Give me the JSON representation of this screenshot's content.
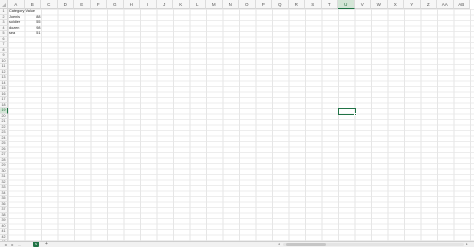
{
  "columns": [
    "A",
    "B",
    "C",
    "D",
    "E",
    "F",
    "G",
    "H",
    "I",
    "J",
    "K",
    "L",
    "M",
    "N",
    "O",
    "P",
    "Q",
    "R",
    "S",
    "T",
    "U",
    "V",
    "W",
    "X",
    "Y",
    "Z",
    "AA",
    "AB"
  ],
  "rows": [
    "1",
    "2",
    "3",
    "4",
    "5",
    "6",
    "7",
    "8",
    "9",
    "10",
    "11",
    "12",
    "13",
    "14",
    "15",
    "16",
    "17",
    "18",
    "19",
    "20",
    "21",
    "22",
    "23",
    "24",
    "25",
    "26",
    "27",
    "28",
    "29",
    "30",
    "31",
    "32",
    "33",
    "34",
    "35",
    "36",
    "37",
    "38",
    "39",
    "40",
    "41",
    "42",
    "43"
  ],
  "active_column": "U",
  "active_row": "19",
  "cells": {
    "header_category": "Category",
    "header_value": "Value",
    "r2_category": "Joenis",
    "r2_value": "88",
    "r3_category": "soldier",
    "r3_value": "55",
    "r4_category": "dozen",
    "r4_value": "98",
    "r5_category": "sea",
    "r5_value": "51"
  },
  "tabbar": {
    "prev_label": "◂",
    "next_label": "▸",
    "add_label": "+",
    "sheet_tab_label": "S"
  },
  "colors": {
    "accent": "#217346"
  }
}
